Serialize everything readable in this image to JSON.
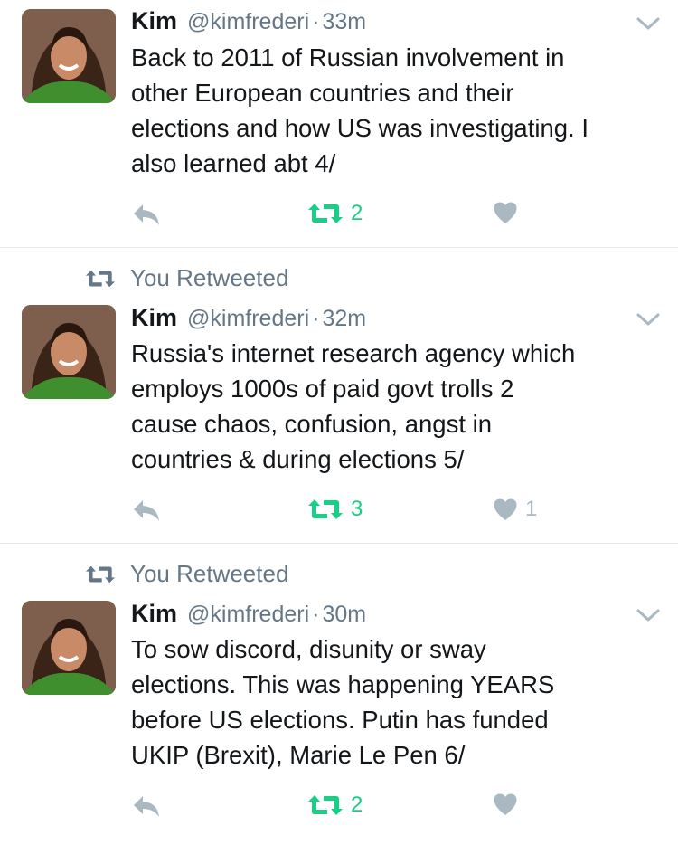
{
  "tweets": [
    {
      "retweeted_banner": "",
      "name": "Kim",
      "handle": "@kimfrederi",
      "sep": "·",
      "time": "33m",
      "text": "Back to 2011 of Russian involvement in\nother European countries and their\nelections and how US was investigating. I\nalso learned abt 4/",
      "retweets": "2",
      "likes": "",
      "colors": {
        "retweet": "#19cf86",
        "muted": "#aab8c2"
      }
    },
    {
      "retweeted_banner": "You Retweeted",
      "name": "Kim",
      "handle": "@kimfrederi",
      "sep": "·",
      "time": "32m",
      "text": "Russia's internet research agency which\nemploys 1000s of paid govt trolls 2\ncause chaos, confusion, angst in\ncountries & during elections 5/",
      "retweets": "3",
      "likes": "1",
      "colors": {
        "retweet": "#19cf86",
        "muted": "#aab8c2"
      }
    },
    {
      "retweeted_banner": "You Retweeted",
      "name": "Kim",
      "handle": "@kimfrederi",
      "sep": "·",
      "time": "30m",
      "text": "To sow discord, disunity or sway\nelections. This was happening YEARS\nbefore US elections. Putin has funded\nUKIP (Brexit), Marie Le Pen 6/",
      "retweets": "2",
      "likes": "",
      "colors": {
        "retweet": "#19cf86",
        "muted": "#aab8c2"
      }
    }
  ],
  "icons": {
    "reply": "reply-icon",
    "retweet": "retweet-icon",
    "like": "heart-icon",
    "more": "chevron-down-icon"
  }
}
